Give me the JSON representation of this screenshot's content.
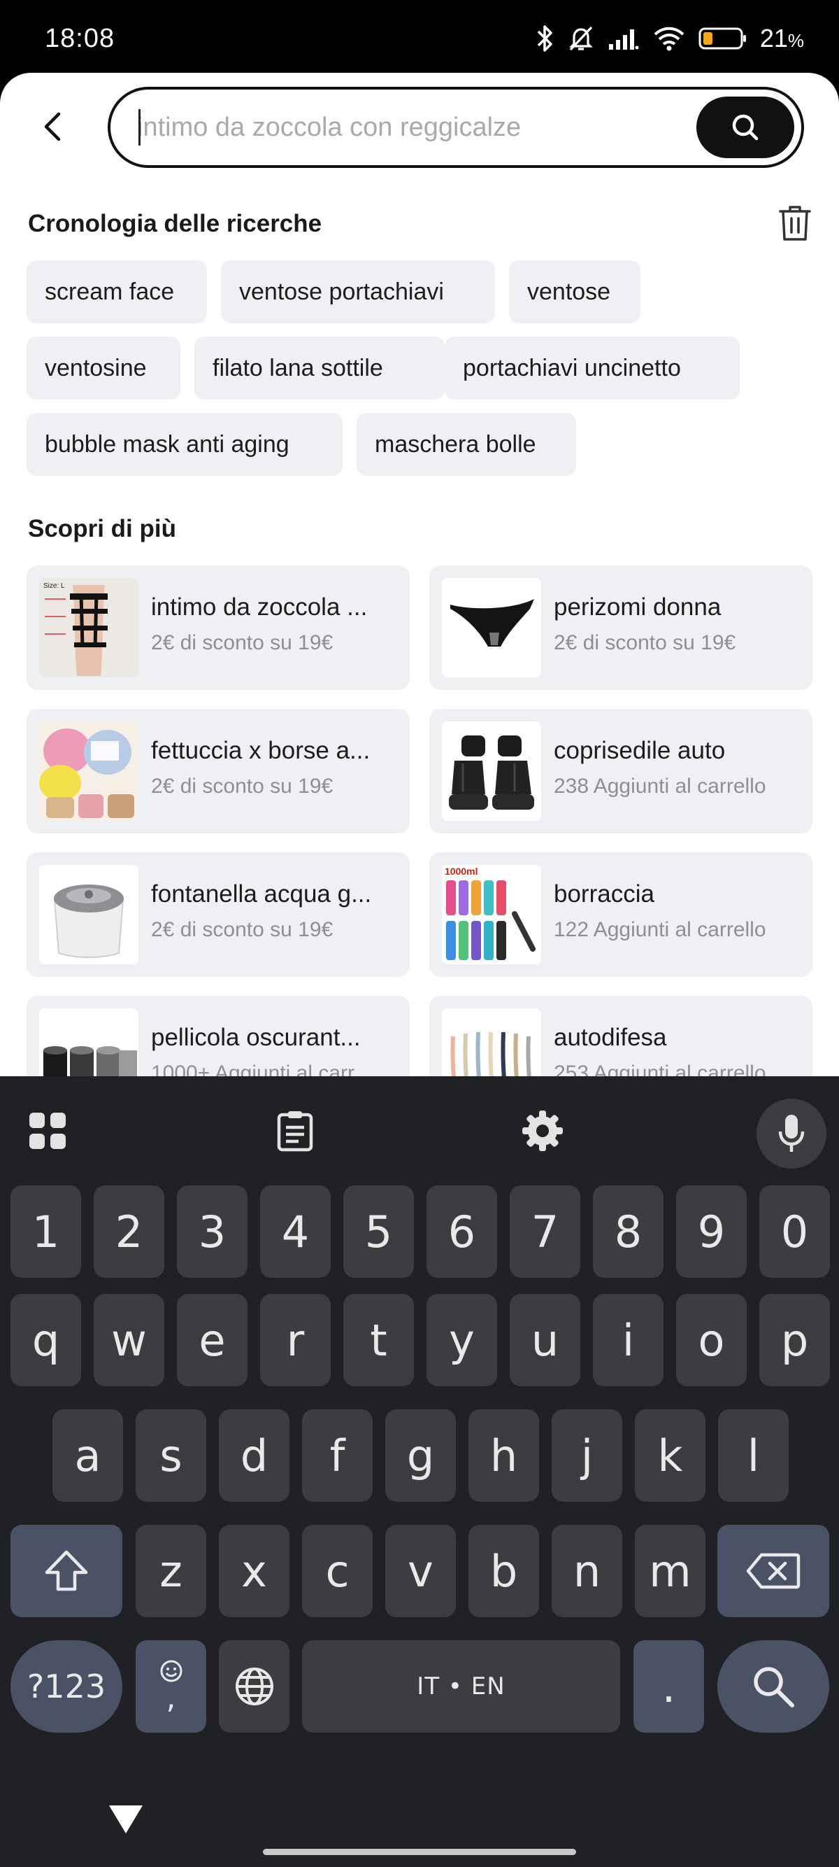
{
  "status_bar": {
    "time": "18:08",
    "battery_percent": "21",
    "battery_suffix": "%",
    "icons": [
      "bluetooth-icon",
      "bell-muted-icon",
      "signal-icon",
      "wifi-icon",
      "battery-icon"
    ]
  },
  "search": {
    "placeholder": "intimo da zoccola con reggicalze",
    "value": ""
  },
  "history": {
    "title": "Cronologia delle ricerche",
    "chips": [
      "scream face",
      "ventose portachiavi",
      "ventose",
      "ventosine",
      "filato lana sottile",
      "portachiavi uncinetto",
      "bubble mask anti aging",
      "maschera bolle"
    ]
  },
  "discover": {
    "title": "Scopri di più",
    "items": [
      {
        "title": "intimo da zoccola ...",
        "subtitle": "2€ di sconto su 19€"
      },
      {
        "title": "perizomi donna",
        "subtitle": "2€ di sconto su 19€"
      },
      {
        "title": "fettuccia x borse a...",
        "subtitle": "2€ di sconto su 19€"
      },
      {
        "title": "coprisedile auto",
        "subtitle": "238 Aggiunti al carrello"
      },
      {
        "title": "fontanella acqua g...",
        "subtitle": "2€ di sconto su 19€"
      },
      {
        "title": "borraccia",
        "subtitle": "122 Aggiunti al carrello"
      },
      {
        "title": "pellicola oscurant...",
        "subtitle": "1000+ Aggiunti al carr..."
      },
      {
        "title": "autodifesa",
        "subtitle": "253 Aggiunti al carrello"
      }
    ],
    "thumb_labels": {
      "size_tag": "Size: L",
      "bottle_tag": "1000ml"
    }
  },
  "keyboard": {
    "row_numbers": [
      "1",
      "2",
      "3",
      "4",
      "5",
      "6",
      "7",
      "8",
      "9",
      "0"
    ],
    "row1": [
      "q",
      "w",
      "e",
      "r",
      "t",
      "y",
      "u",
      "i",
      "o",
      "p"
    ],
    "row2": [
      "a",
      "s",
      "d",
      "f",
      "g",
      "h",
      "j",
      "k",
      "l"
    ],
    "row3": [
      "z",
      "x",
      "c",
      "v",
      "b",
      "n",
      "m"
    ],
    "symbols_label": "?123",
    "comma_label": ",",
    "space_label": "IT • EN",
    "period_label": ".",
    "colors": {
      "background": "#202124",
      "key": "#3c3d40",
      "special_key": "#4a5266"
    }
  }
}
